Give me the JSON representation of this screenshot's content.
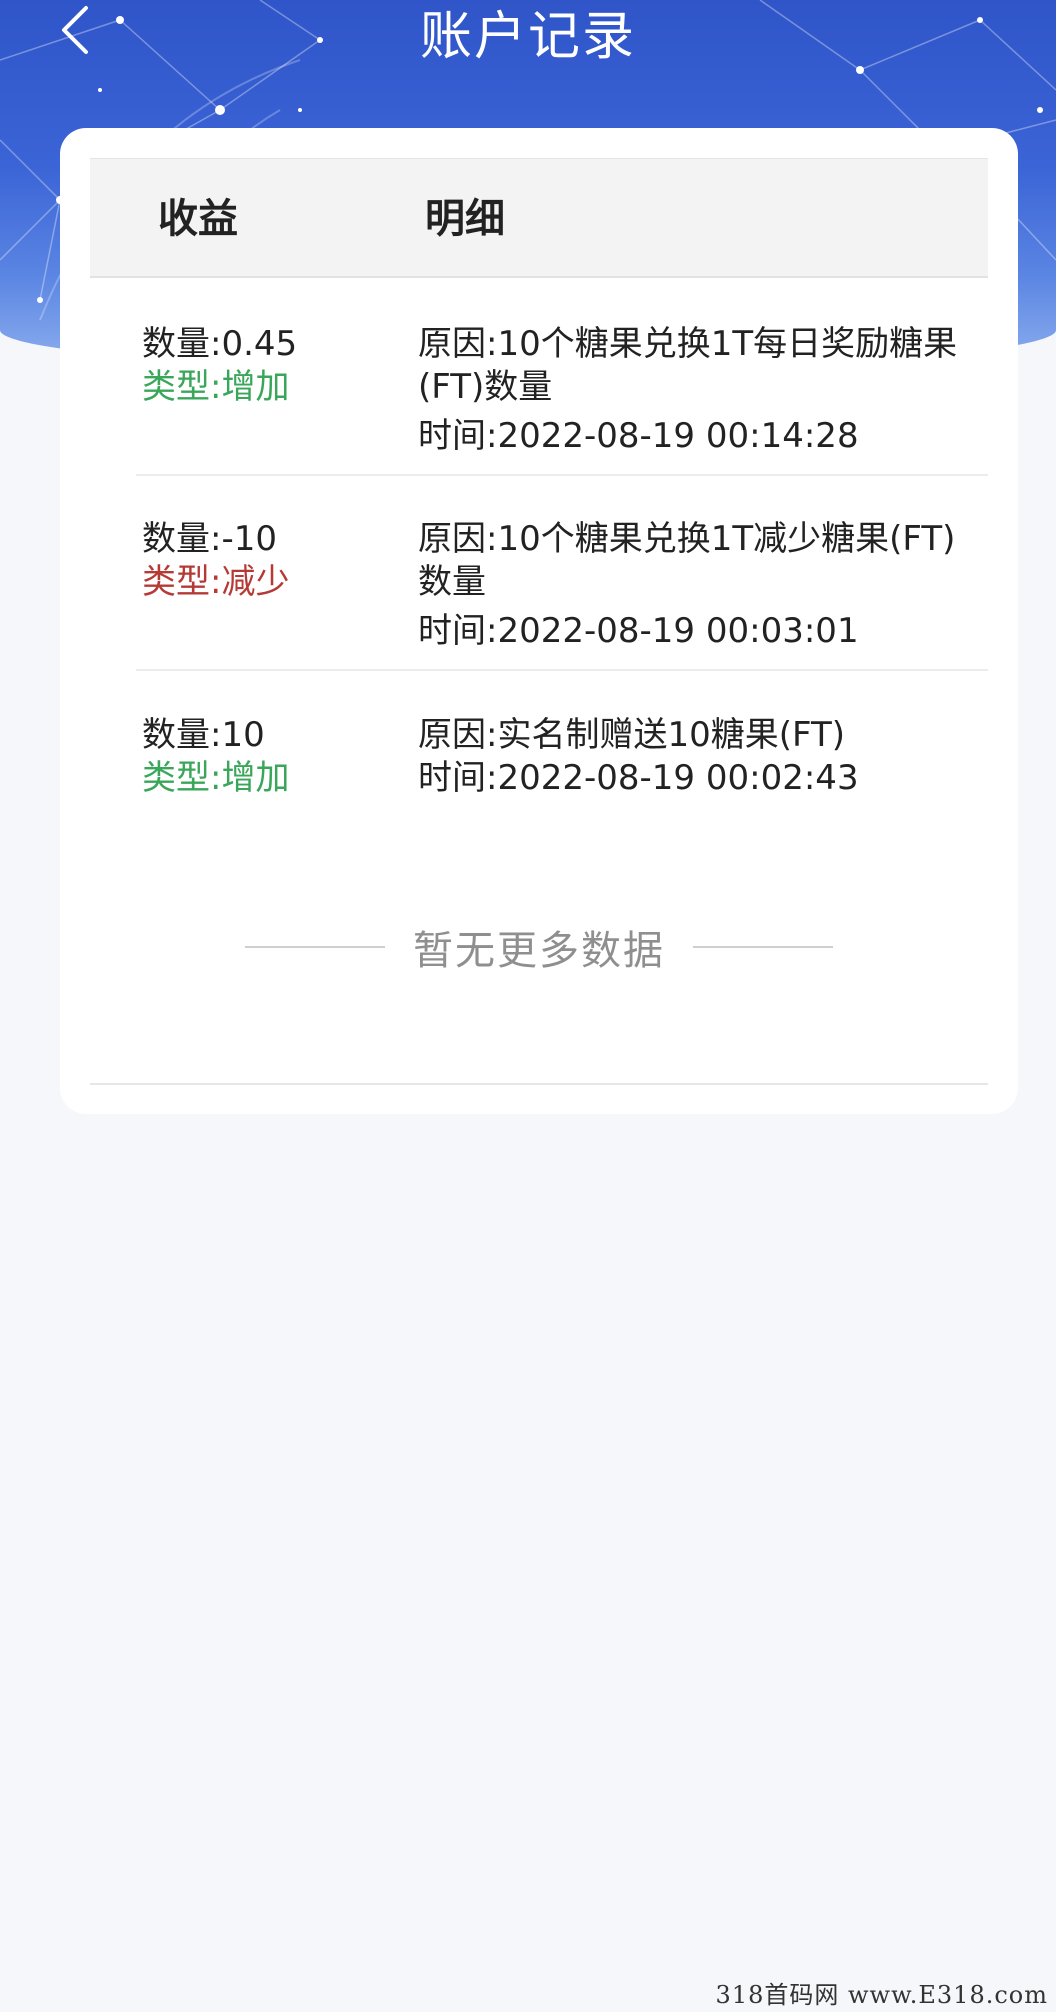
{
  "header": {
    "title": "账户记录"
  },
  "table": {
    "col_income": "收益",
    "col_detail": "明细",
    "rows": [
      {
        "qty_label": "数量:",
        "qty_value": "0.45",
        "type_label": "类型:",
        "type_value": "增加",
        "reason_label": "原因:",
        "reason_value": "10个糖果兑换1T每日奖励糖果(FT)数量",
        "time_label": "时间:",
        "time_value": "2022-08-19 00:14:28"
      },
      {
        "qty_label": "数量:",
        "qty_value": "-10",
        "type_label": "类型:",
        "type_value": "减少",
        "reason_label": "原因:",
        "reason_value": "10个糖果兑换1T减少糖果(FT)数量",
        "time_label": "时间:",
        "time_value": "2022-08-19 00:03:01"
      },
      {
        "qty_label": "数量:",
        "qty_value": "10",
        "type_label": "类型:",
        "type_value": "增加",
        "reason_label": "原因:",
        "reason_value": "实名制赠送10糖果(FT)",
        "time_label": "时间:",
        "time_value": "2022-08-19 00:02:43"
      }
    ]
  },
  "footer": {
    "no_more": "暂无更多数据"
  },
  "watermark": "318首码网 www.E318.com",
  "colors": {
    "increase": "#3aa65a",
    "decrease": "#b53a36",
    "header_blue": "#3b64d6"
  },
  "icons": {
    "back": "chevron-left-icon"
  }
}
